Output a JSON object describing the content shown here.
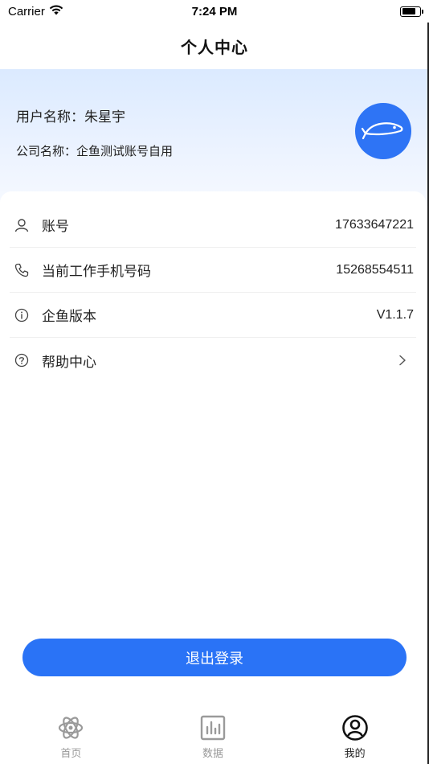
{
  "status_bar": {
    "carrier": "Carrier",
    "time": "7:24 PM"
  },
  "nav": {
    "title": "个人中心"
  },
  "profile": {
    "user_name": "用户名称：朱星宇",
    "company_name": "公司名称：企鱼测试账号自用",
    "avatar_icon": "fish-icon",
    "avatar_color": "#2e74f5"
  },
  "info_rows": [
    {
      "icon": "person-icon",
      "label": "账号",
      "value": "17633647221"
    },
    {
      "icon": "phone-icon",
      "label": "当前工作手机号码",
      "value": "15268554511"
    },
    {
      "icon": "info-icon",
      "label": "企鱼版本",
      "value": "V1.1.7"
    },
    {
      "icon": "help-icon",
      "label": "帮助中心",
      "value": ""
    }
  ],
  "logout": {
    "label": "退出登录",
    "color": "#2a73f6"
  },
  "tabs": [
    {
      "icon": "atom-icon",
      "label": "首页",
      "active": false
    },
    {
      "icon": "data-chart-icon",
      "label": "数据",
      "active": false
    },
    {
      "icon": "user-circle-icon",
      "label": "我的",
      "active": true
    }
  ]
}
